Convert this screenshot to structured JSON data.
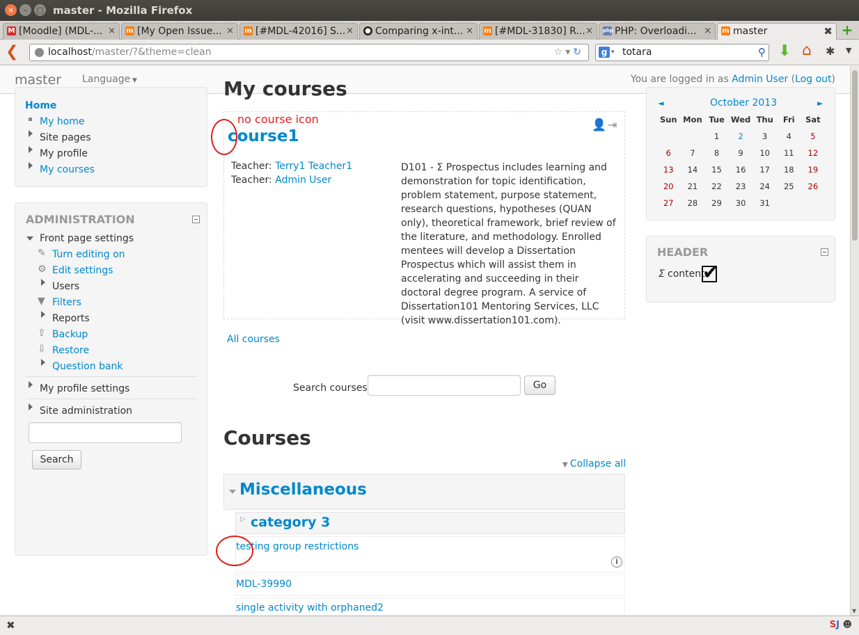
{
  "window": {
    "title": "master - Mozilla Firefox"
  },
  "tabs": [
    {
      "label": "[Moodle] (MDL-...",
      "icon": "gmail-icon"
    },
    {
      "label": "[My Open Issue...",
      "icon": "moodle-icon"
    },
    {
      "label": "[#MDL-42016] S...",
      "icon": "moodle-icon"
    },
    {
      "label": "Comparing x-int...",
      "icon": "github-icon"
    },
    {
      "label": "[#MDL-31830] R...",
      "icon": "moodle-icon"
    },
    {
      "label": "PHP: Overloadi...",
      "icon": "php-icon"
    },
    {
      "label": "master",
      "icon": "moodle-icon"
    }
  ],
  "urlbar": {
    "host": "localhost",
    "path": "/master/?&theme=clean"
  },
  "searchbar": {
    "value": "totara"
  },
  "moodle_nav": {
    "brand": "master",
    "language": "Language",
    "login_prefix": "You are logged in as",
    "user": "Admin User",
    "logout_open": "(",
    "logout": "Log out",
    "logout_close": ")"
  },
  "nav_block": {
    "home": "Home",
    "items": [
      "My home",
      "Site pages",
      "My profile",
      "My courses"
    ]
  },
  "admin_block": {
    "title": "ADMINISTRATION",
    "front_page": "Front page settings",
    "items": [
      "Turn editing on",
      "Edit settings",
      "Users",
      "Filters",
      "Reports",
      "Backup",
      "Restore",
      "Question bank"
    ],
    "profile_settings": "My profile settings",
    "site_admin": "Site administration",
    "search_button": "Search"
  },
  "main": {
    "my_courses_heading": "My courses",
    "annotation_top": "no course icon",
    "course_name": "course1",
    "teacher_label": "Teacher:",
    "teachers": [
      "Terry1 Teacher1",
      "Admin User"
    ],
    "summary": "D101 - Σ Prospectus includes learning and demonstration for topic identification, problem statement, purpose statement, research questions, hypotheses (QUAN only), theoretical framework, brief review of the literature, and methodology. Enrolled mentees will develop a Dissertation Prospectus which will assist them in accelerating and succeeding in their doctoral degree program. A service of Dissertation101 Mentoring Services, LLC (visit www.dissertation101.com).",
    "all_courses": "All courses",
    "search_label": "Search courses:",
    "go_button": "Go",
    "courses_heading": "Courses",
    "collapse_all": "Collapse all",
    "category_top": "Miscellaneous",
    "subcategory": "category 3",
    "course_list": [
      "testing group restrictions",
      "MDL-39990",
      "single activity with orphaned2"
    ]
  },
  "calendar": {
    "month": "October 2013",
    "prev": "◄",
    "next": "►",
    "days": [
      "Sun",
      "Mon",
      "Tue",
      "Wed",
      "Thu",
      "Fri",
      "Sat"
    ]
  },
  "header_block": {
    "title": "HEADER",
    "content": "content"
  }
}
